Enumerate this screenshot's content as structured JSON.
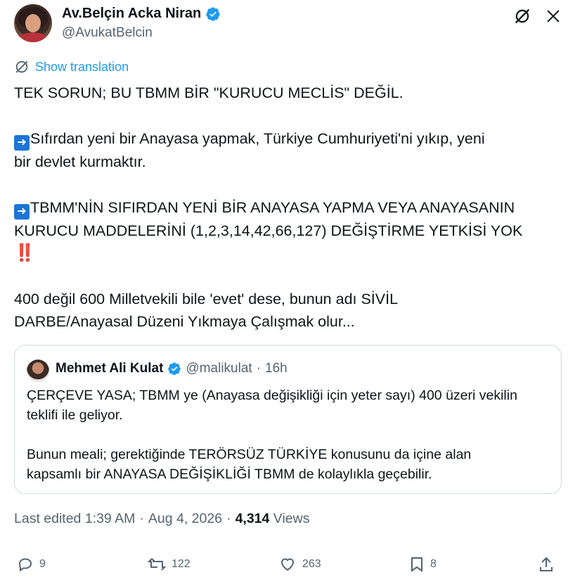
{
  "author": {
    "display_name": "Av.Belçin Acka Niran",
    "handle": "@AvukatBelcin"
  },
  "translate_label": "Show translation",
  "tweet": {
    "line1": "TEK SORUN; BU TBMM BİR \"KURUCU MECLİS\" DEĞİL.",
    "para2_line1": "Sıfırdan yeni bir Anayasa yapmak, Türkiye Cumhuriyeti'ni yıkıp, yeni",
    "para2_line2": "bir devlet kurmaktır.",
    "para3_line1": "TBMM'NİN SIFIRDAN YENİ BİR ANAYASA YAPMA VEYA ANAYASANIN",
    "para3_line2": "KURUCU MADDELERİNİ (1,2,3,14,42,66,127) DEĞİŞTİRME YETKİSİ YOK",
    "para3_emoji": "‼️",
    "para4_line1": "400 değil 600 Milletvekili bile 'evet' dese, bunun adı SİVİL",
    "para4_line2": "DARBE/Anayasal Düzeni Yıkmaya Çalışmak olur..."
  },
  "quote": {
    "display_name": "Mehmet Ali Kulat",
    "handle": "@malikulat",
    "separator": "·",
    "time": "16h",
    "para1_line1": "ÇERÇEVE YASA; TBMM ye (Anayasa değişikliği için yeter sayı) 400 üzeri vekilin",
    "para1_line2": "teklifi ile geliyor.",
    "para2_line1": "Bunun meali; gerektiğinde TERÖRSÜZ TÜRKİYE konusunu da içine alan",
    "para2_line2": "kapsamlı bir ANAYASA DEĞİŞİKLİĞİ TBMM de kolaylıkla geçebilir."
  },
  "meta": {
    "edited": "Last edited 1:39 AM",
    "dot1": "·",
    "date": "Aug 4, 2026",
    "dot2": "·",
    "views_count": "4,314",
    "views_label": "Views"
  },
  "actions": {
    "replies": "9",
    "reposts": "122",
    "likes": "263",
    "bookmarks": "8"
  },
  "colors": {
    "accent": "#1d9bf0",
    "text": "#0f1419",
    "secondary": "#536471",
    "border": "#cfd9de"
  },
  "icons": [
    "verified-badge-icon",
    "grok-icon",
    "close-icon",
    "translate-icon",
    "arrow-right-emoji-icon",
    "reply-icon",
    "repost-icon",
    "like-icon",
    "bookmark-icon",
    "share-icon"
  ]
}
